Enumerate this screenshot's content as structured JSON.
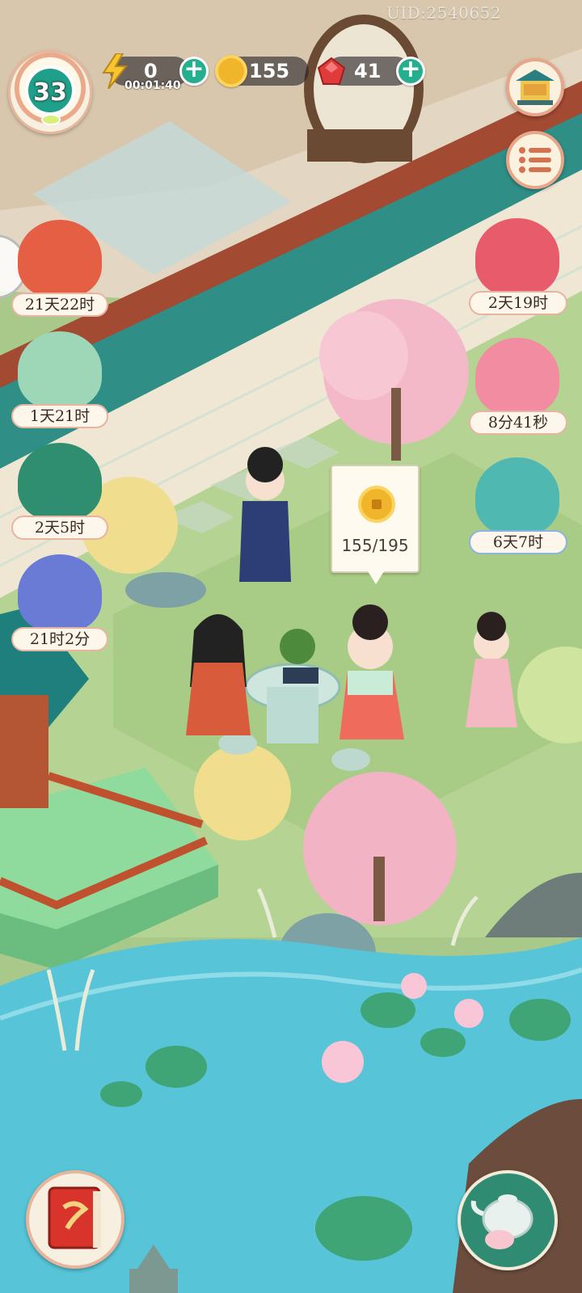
{
  "hud": {
    "uid": "UID:2540652",
    "level": "33",
    "energy": {
      "value": "0",
      "timer": "00:01:40"
    },
    "coins": {
      "value": "155"
    },
    "gems": {
      "value": "41"
    },
    "plus_label": "+"
  },
  "events": {
    "left": [
      {
        "label": "21天22时"
      },
      {
        "label": "1天21时"
      },
      {
        "label": "2天5时"
      },
      {
        "label": "21时2分"
      }
    ],
    "right": [
      {
        "label": "2天19时"
      },
      {
        "label": "8分41秒"
      },
      {
        "label": "6天7时"
      }
    ]
  },
  "tooltip": {
    "text": "155/195"
  },
  "icons": {
    "energy": "lightning-icon",
    "coin": "coin-icon",
    "gem": "ruby-icon",
    "shop": "treasure-pavilion-icon",
    "menu": "list-menu-icon",
    "book": "journal-book-icon",
    "tea": "teapot-icon"
  },
  "colors": {
    "accent_green": "#24b08f",
    "label_border": "#e7b4a2",
    "water": "#57c4d8",
    "grass": "#a9c98a"
  }
}
